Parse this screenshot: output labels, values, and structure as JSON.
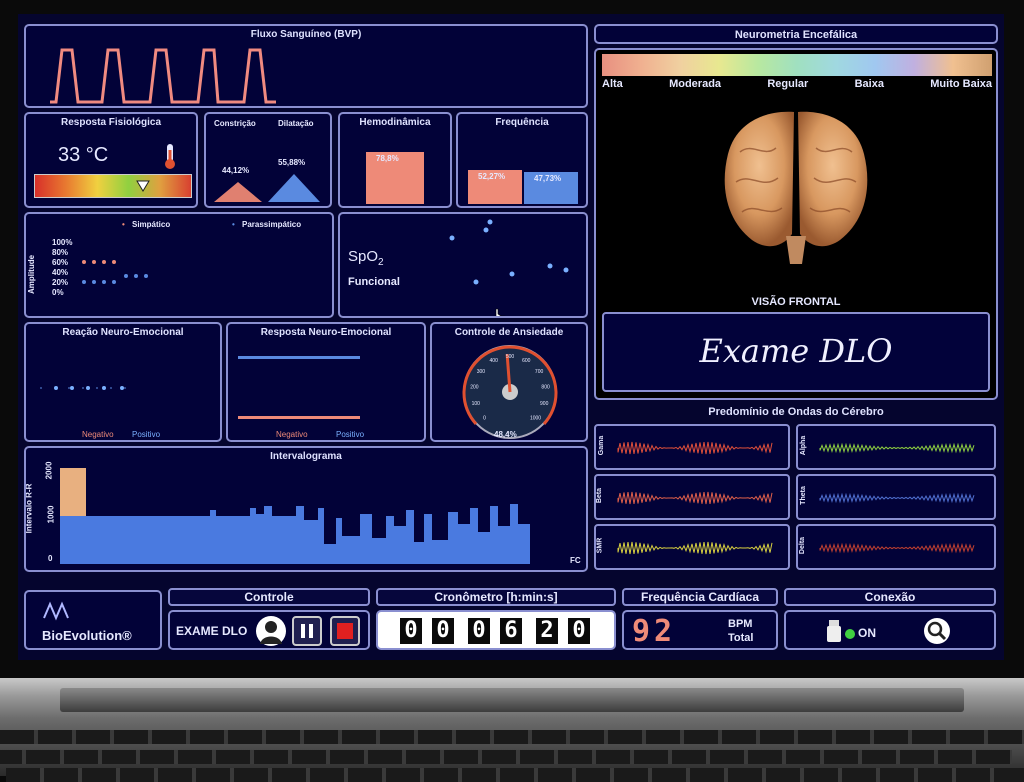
{
  "app": {
    "brand": "BioEvolution®"
  },
  "bvp": {
    "title": "Fluxo Sanguíneo (BVP)"
  },
  "resposta": {
    "title": "Resposta Fisiológica",
    "temp": "33 °C"
  },
  "constricao": {
    "title_a": "Constrição",
    "title_b": "Dilatação",
    "val_a": "44,12%",
    "val_b": "55,88%"
  },
  "hemo": {
    "title": "Hemodinâmica",
    "value": "78,8%"
  },
  "freq": {
    "title": "Frequência",
    "val_a": "52,27%",
    "val_b": "47,73%"
  },
  "autonomo": {
    "legend_sim": "Simpático",
    "legend_para": "Parassimpático",
    "ylabel": "Amplitude",
    "ticks": [
      "100%",
      "80%",
      "60%",
      "40%",
      "20%",
      "0%"
    ]
  },
  "spo2": {
    "label": "SpO",
    "sub": "2",
    "func": "Funcional"
  },
  "reacao": {
    "title": "Reação Neuro-Emocional",
    "neg": "Negativo",
    "pos": "Positivo"
  },
  "resposta_neuro": {
    "title": "Resposta Neuro-Emocional",
    "neg": "Negativo",
    "pos": "Positivo"
  },
  "ansiedade": {
    "title": "Controle de Ansiedade",
    "value": "48,4%",
    "ticks": [
      "0",
      "100",
      "200",
      "300",
      "400",
      "500",
      "600",
      "700",
      "800",
      "900",
      "1000"
    ],
    "level": 0.484
  },
  "intervalograma": {
    "title": "Intervalograma",
    "ylabel": "Intervalo R-R",
    "yticks": [
      "2000",
      "1000",
      "0"
    ],
    "xlabel": "FC"
  },
  "neurometria": {
    "title": "Neurometria Encefálica",
    "scale": [
      "Alta",
      "Moderada",
      "Regular",
      "Baixa",
      "Muito Baixa"
    ],
    "view": "VISÃO FRONTAL",
    "exam": "Exame DLO"
  },
  "ondas": {
    "title": "Predomínio de Ondas do Cérebro",
    "left": [
      {
        "name": "Gama",
        "color": "#e0503a"
      },
      {
        "name": "Beta",
        "color": "#e0604a"
      },
      {
        "name": "SMR",
        "color": "#d8d040"
      }
    ],
    "right": [
      {
        "name": "Alpha",
        "color": "#8fd040"
      },
      {
        "name": "Theta",
        "color": "#5070d0"
      },
      {
        "name": "Delta",
        "color": "#c04030"
      }
    ]
  },
  "controle": {
    "title": "Controle",
    "mode": "EXAME DLO"
  },
  "cronometro": {
    "title": "Cronômetro [h:min:s]",
    "digits": [
      "0",
      "0",
      "0",
      "6",
      "2",
      "0"
    ]
  },
  "fc": {
    "title": "Frequência Cardíaca",
    "value": "92",
    "unit": "BPM",
    "total": "Total"
  },
  "conexao": {
    "title": "Conexão",
    "status": "ON"
  }
}
